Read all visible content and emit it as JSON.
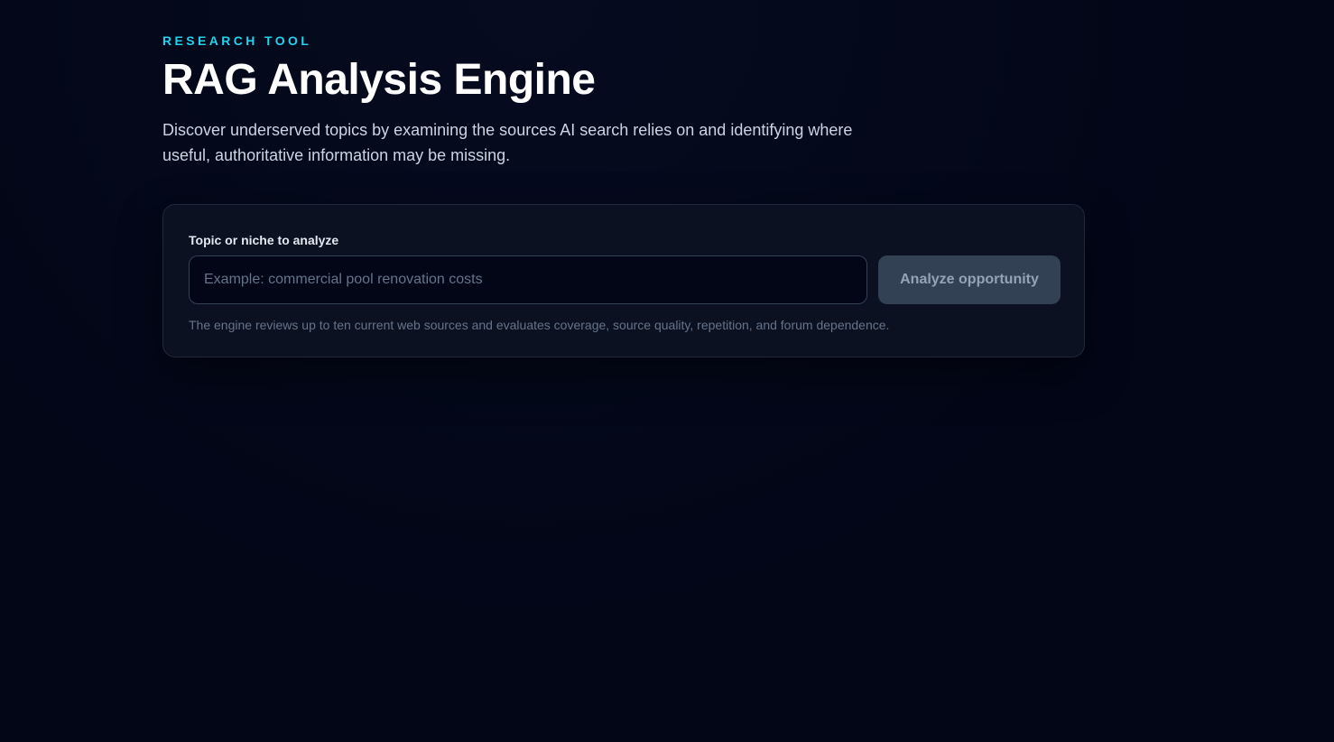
{
  "header": {
    "eyebrow": "RESEARCH TOOL",
    "title": "RAG Analysis Engine",
    "description": "Discover underserved topics by examining the sources AI search relies on and identifying where useful, authoritative information may be missing."
  },
  "form": {
    "label": "Topic or niche to analyze",
    "input_value": "",
    "placeholder": "Example: commercial pool renovation costs",
    "button_label": "Analyze opportunity",
    "helper_text": "The engine reviews up to ten current web sources and evaluates coverage, source quality, repetition, and forum dependence."
  },
  "colors": {
    "background": "#020617",
    "accent": "#22d3ee",
    "card": "#0b1120",
    "button_disabled": "#334155"
  }
}
